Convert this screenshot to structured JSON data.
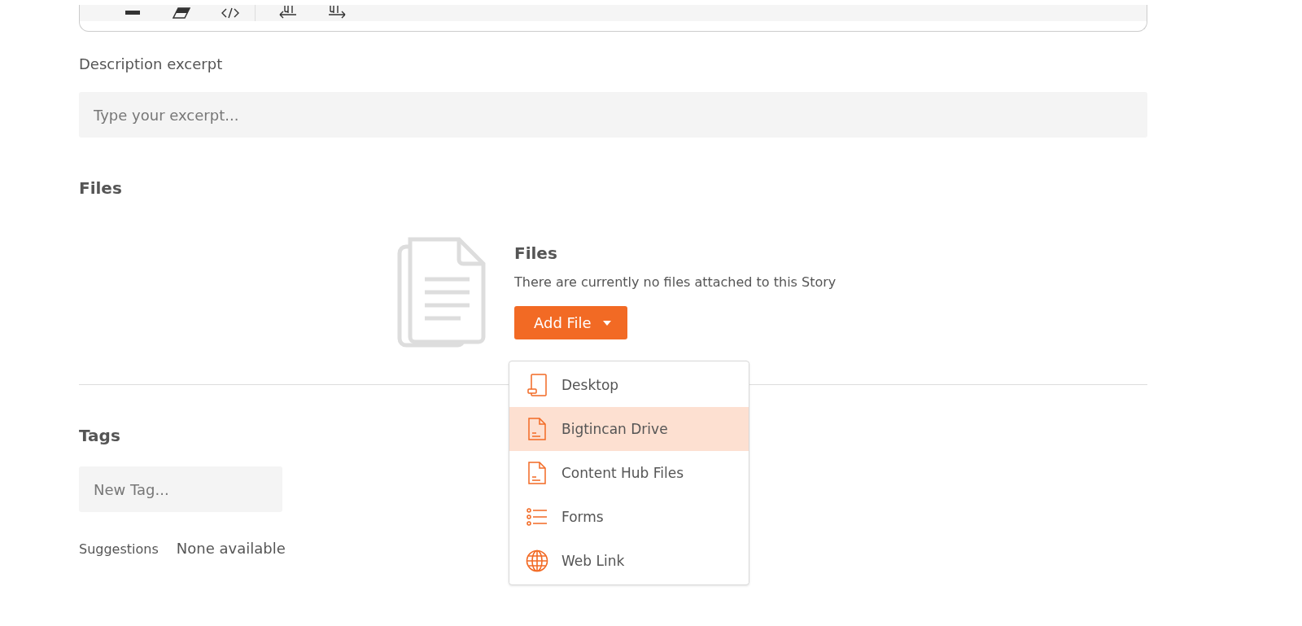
{
  "description_excerpt": {
    "label": "Description excerpt",
    "placeholder": "Type your excerpt..."
  },
  "files": {
    "heading": "Files",
    "empty_title": "Files",
    "empty_message": "There are currently no files attached to this Story",
    "add_button": "Add File",
    "menu": [
      {
        "label": "Desktop",
        "selected": false
      },
      {
        "label": "Bigtincan Drive",
        "selected": true
      },
      {
        "label": "Content Hub Files",
        "selected": false
      },
      {
        "label": "Forms",
        "selected": false
      },
      {
        "label": "Web Link",
        "selected": false
      }
    ]
  },
  "tags": {
    "heading": "Tags",
    "placeholder": "New Tag...",
    "suggestions_label": "Suggestions",
    "suggestions_value": "None available"
  }
}
